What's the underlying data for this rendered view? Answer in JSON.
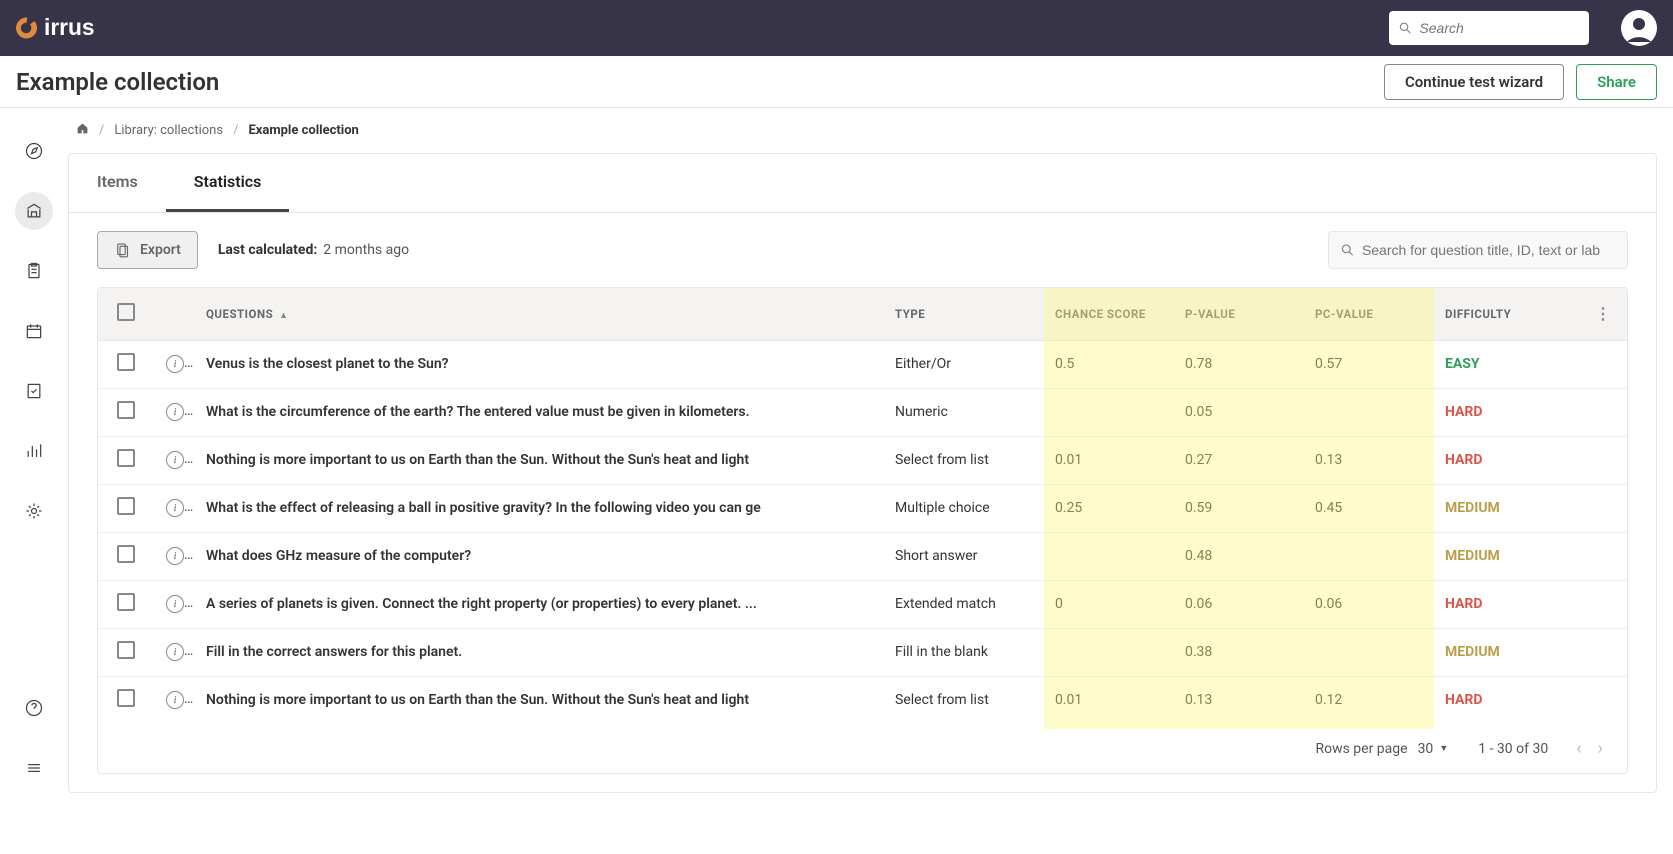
{
  "topbar": {
    "logo_text": "cirrus",
    "search_placeholder": "Search"
  },
  "header": {
    "title": "Example collection",
    "continue_btn": "Continue test wizard",
    "share_btn": "Share"
  },
  "breadcrumb": {
    "items": [
      {
        "label": "Library: collections",
        "current": false
      },
      {
        "label": "Example collection",
        "current": true
      }
    ]
  },
  "tabs": {
    "items_tab": "Items",
    "stats_tab": "Statistics"
  },
  "toolbar": {
    "export_label": "Export",
    "last_calc_label": "Last calculated:",
    "last_calc_value": "2 months ago",
    "table_search_placeholder": "Search for question title, ID, text or lab"
  },
  "table": {
    "headers": {
      "questions": "QUESTIONS",
      "type": "TYPE",
      "chance": "CHANCE SCORE",
      "pvalue": "P-VALUE",
      "pcvalue": "PC-VALUE",
      "difficulty": "DIFFICULTY"
    },
    "rows": [
      {
        "question": "Venus is the closest planet to the Sun?",
        "type": "Either/Or",
        "chance": "0.5",
        "p": "0.78",
        "pc": "0.57",
        "difficulty": "EASY"
      },
      {
        "question": "What is the circumference of the earth? The entered value must be given in kilometers.",
        "type": "Numeric",
        "chance": "",
        "p": "0.05",
        "pc": "",
        "difficulty": "HARD"
      },
      {
        "question": "Nothing is more important to us on Earth than the Sun. Without the Sun's heat and light",
        "type": "Select from list",
        "chance": "0.01",
        "p": "0.27",
        "pc": "0.13",
        "difficulty": "HARD"
      },
      {
        "question": "What is the effect of releasing a ball in positive gravity? In the following video you can ge",
        "type": "Multiple choice",
        "chance": "0.25",
        "p": "0.59",
        "pc": "0.45",
        "difficulty": "MEDIUM"
      },
      {
        "question": "What does GHz measure of the computer?",
        "type": "Short answer",
        "chance": "",
        "p": "0.48",
        "pc": "",
        "difficulty": "MEDIUM"
      },
      {
        "question": "A series of planets is given. Connect the right property (or properties) to every planet. ...",
        "type": "Extended match",
        "chance": "0",
        "p": "0.06",
        "pc": "0.06",
        "difficulty": "HARD"
      },
      {
        "question": "Fill in the correct answers for this planet.",
        "type": "Fill in the blank",
        "chance": "",
        "p": "0.38",
        "pc": "",
        "difficulty": "MEDIUM"
      },
      {
        "question": "Nothing is more important to us on Earth than the Sun. Without the Sun's heat and light",
        "type": "Select from list",
        "chance": "0.01",
        "p": "0.13",
        "pc": "0.12",
        "difficulty": "HARD"
      }
    ]
  },
  "pagination": {
    "rows_per_page_label": "Rows per page",
    "rows_per_page_value": "30",
    "range": "1 - 30 of 30"
  }
}
